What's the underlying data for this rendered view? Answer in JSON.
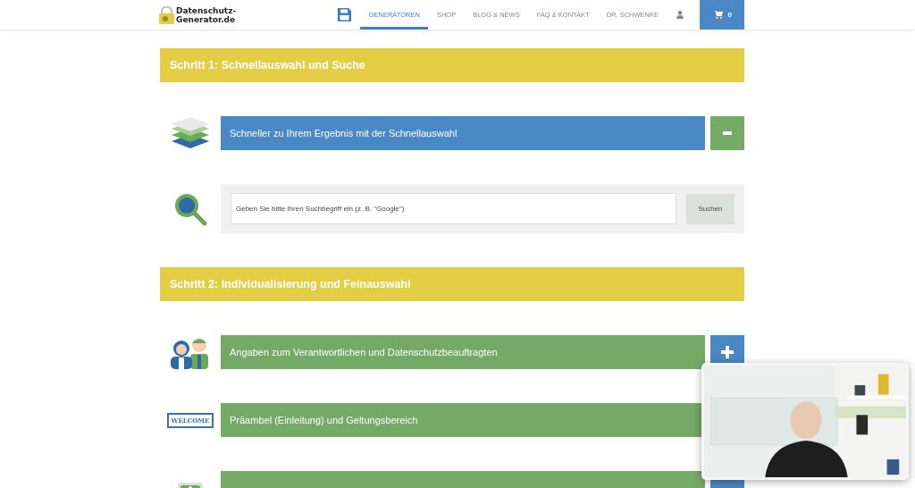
{
  "header": {
    "logo_lines": [
      "Datenschutz-",
      "Generator.de"
    ],
    "nav": [
      {
        "label": "GENERATOREN",
        "selected": true
      },
      {
        "label": "SHOP",
        "selected": false
      },
      {
        "label": "BLOG & NEWS",
        "selected": false
      },
      {
        "label": "FAQ & KONTAKT",
        "selected": false
      },
      {
        "label": "DR. SCHWENKE",
        "selected": false
      }
    ],
    "cart_count": "0"
  },
  "steps": [
    {
      "title": "Schritt 1: Schnellauswahl und Suche",
      "sections": [
        {
          "kind": "accordion",
          "label": "Schneller zu Ihrem Ergebnis mit der Schnellauswahl",
          "expanded": true
        },
        {
          "kind": "search",
          "placeholder": "Geben Sie bitte Ihren Suchbegriff ein (z. B. \"Google\")",
          "button": "Suchen"
        }
      ]
    },
    {
      "title": "Schritt 2: Individualisierung und Feinauswahl",
      "sections": [
        {
          "kind": "accordion",
          "label": "Angaben zum Verantwortlichen und Datenschutzbeauftragten",
          "expanded": false
        },
        {
          "kind": "accordion",
          "label": "Präambel (Einleitung) und Geltungsbereich",
          "expanded": false,
          "icon_text": "WELCOME",
          "button_covered": true
        },
        {
          "kind": "accordion",
          "expanded": false
        }
      ]
    }
  ]
}
